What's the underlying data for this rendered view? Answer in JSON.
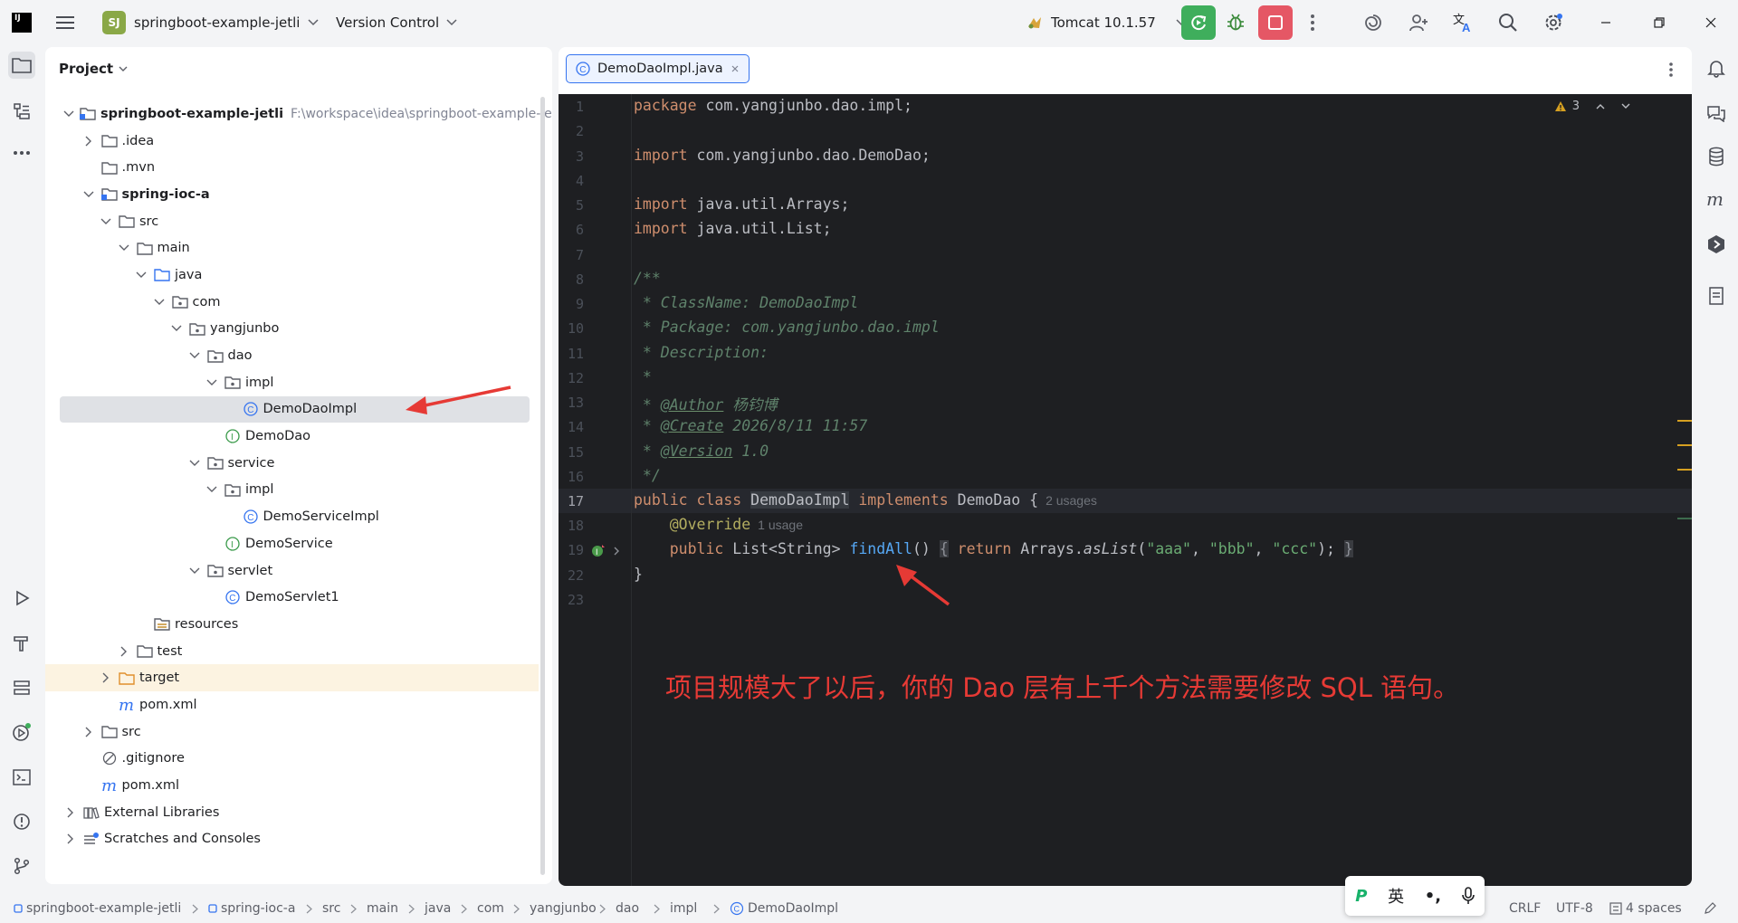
{
  "titlebar": {
    "logo": "IJ",
    "project_badge": "SJ",
    "project_name": "springboot-example-jetli",
    "vcs_label": "Version Control",
    "run_config": "Tomcat 10.1.57"
  },
  "project_panel": {
    "title": "Project",
    "tree": [
      {
        "label": "springboot-example-jetli",
        "path": "F:\\workspace\\idea\\springboot-example-jetli",
        "depth": 0,
        "chevron": "down",
        "icon": "module",
        "bold": true
      },
      {
        "label": ".idea",
        "depth": 1,
        "chevron": "right",
        "icon": "folder"
      },
      {
        "label": ".mvn",
        "depth": 1,
        "chevron": "none",
        "icon": "folder"
      },
      {
        "label": "spring-ioc-a",
        "depth": 1,
        "chevron": "down",
        "icon": "module",
        "bold": true
      },
      {
        "label": "src",
        "depth": 2,
        "chevron": "down",
        "icon": "folder"
      },
      {
        "label": "main",
        "depth": 3,
        "chevron": "down",
        "icon": "folder"
      },
      {
        "label": "java",
        "depth": 4,
        "chevron": "down",
        "icon": "src-folder"
      },
      {
        "label": "com",
        "depth": 5,
        "chevron": "down",
        "icon": "package"
      },
      {
        "label": "yangjunbo",
        "depth": 6,
        "chevron": "down",
        "icon": "package"
      },
      {
        "label": "dao",
        "depth": 7,
        "chevron": "down",
        "icon": "package"
      },
      {
        "label": "impl",
        "depth": 8,
        "chevron": "down",
        "icon": "package"
      },
      {
        "label": "DemoDaoImpl",
        "depth": 9,
        "chevron": "none",
        "icon": "class",
        "selected": true
      },
      {
        "label": "DemoDao",
        "depth": 8,
        "chevron": "none",
        "icon": "interface"
      },
      {
        "label": "service",
        "depth": 7,
        "chevron": "down",
        "icon": "package"
      },
      {
        "label": "impl",
        "depth": 8,
        "chevron": "down",
        "icon": "package"
      },
      {
        "label": "DemoServiceImpl",
        "depth": 9,
        "chevron": "none",
        "icon": "class"
      },
      {
        "label": "DemoService",
        "depth": 8,
        "chevron": "none",
        "icon": "interface"
      },
      {
        "label": "servlet",
        "depth": 7,
        "chevron": "down",
        "icon": "package"
      },
      {
        "label": "DemoServlet1",
        "depth": 8,
        "chevron": "none",
        "icon": "class"
      },
      {
        "label": "resources",
        "depth": 4,
        "chevron": "none",
        "icon": "res-folder"
      },
      {
        "label": "test",
        "depth": 3,
        "chevron": "right",
        "icon": "folder"
      },
      {
        "label": "target",
        "depth": 2,
        "chevron": "right",
        "icon": "target-folder",
        "excluded": true
      },
      {
        "label": "pom.xml",
        "depth": 2,
        "chevron": "none",
        "icon": "maven"
      },
      {
        "label": "src",
        "depth": 1,
        "chevron": "right",
        "icon": "folder"
      },
      {
        "label": ".gitignore",
        "depth": 1,
        "chevron": "none",
        "icon": "ignore"
      },
      {
        "label": "pom.xml",
        "depth": 1,
        "chevron": "none",
        "icon": "maven"
      },
      {
        "label": "External Libraries",
        "depth": 0,
        "chevron": "right",
        "icon": "library"
      },
      {
        "label": "Scratches and Consoles",
        "depth": 0,
        "chevron": "right",
        "icon": "scratch"
      }
    ]
  },
  "editor": {
    "tab_label": "DemoDaoImpl.java",
    "warning_count": "3",
    "line_numbers": [
      "1",
      "2",
      "3",
      "4",
      "5",
      "6",
      "7",
      "8",
      "9",
      "10",
      "11",
      "12",
      "13",
      "14",
      "15",
      "16",
      "17",
      "18",
      "19",
      "22",
      "23"
    ],
    "current_line": "17",
    "code": {
      "l1_kw": "package",
      "l1_rest": " com.yangjunbo.dao.impl;",
      "l3_kw": "import",
      "l3_rest": " com.yangjunbo.dao.DemoDao;",
      "l5_kw": "import",
      "l5_rest": " java.util.Arrays;",
      "l6_kw": "import",
      "l6_rest": " java.util.List;",
      "l8": "/**",
      "l9": " * ClassName: DemoDaoImpl",
      "l10": " * Package: com.yangjunbo.dao.impl",
      "l11": " * Description:",
      "l12": " *",
      "l13_pre": " * ",
      "l13_tag": "@Author",
      "l13_val": " 杨钧博",
      "l14_pre": " * ",
      "l14_tag": "@Create",
      "l14_val": " 2026/8/11 11:57",
      "l15_pre": " * ",
      "l15_tag": "@Version",
      "l15_val": " 1.0",
      "l16": " */",
      "l17_kw": "public class",
      "l17_cls": "DemoDaoImpl",
      "l17_kw2": "implements",
      "l17_rest": " DemoDao {",
      "l17_hint": "2 usages",
      "l18_ann": "@Override",
      "l18_hint": "1 usage",
      "l19_kw": "public",
      "l19_type": " List<String> ",
      "l19_fn": "findAll",
      "l19_paren": "() ",
      "l19_open": "{",
      "l19_ret": "return",
      "l19_call": " Arrays.",
      "l19_it": "asList",
      "l19_s1": "\"aaa\"",
      "l19_s2": "\"bbb\"",
      "l19_s3": "\"ccc\"",
      "l19_close": "}",
      "l22": "}"
    },
    "annotation": "项目规模大了以后，你的 Dao 层有上千个方法需要修改 SQL 语句。"
  },
  "statusbar": {
    "crumbs": [
      "springboot-example-jetli",
      "spring-ioc-a",
      "src",
      "main",
      "java",
      "com",
      "yangjunbo",
      "dao",
      "impl",
      "DemoDaoImpl"
    ],
    "line_sep": "CRLF",
    "encoding": "UTF-8",
    "indent": "4 spaces"
  },
  "ime": {
    "mode": "英",
    "punct": "•,",
    "logo": "P"
  },
  "colors": {
    "accent": "#3574f0",
    "run_green": "#3fae5c",
    "stop_red": "#e55765",
    "annotation_red": "#e63a35"
  }
}
